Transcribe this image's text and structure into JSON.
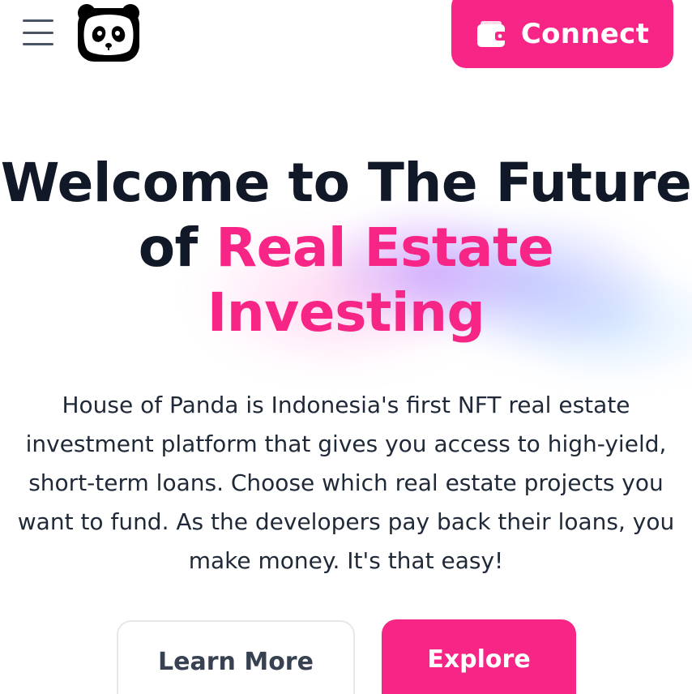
{
  "header": {
    "menu_icon": "hamburger-menu-icon",
    "logo_icon": "panda-logo-icon",
    "connect_button": {
      "label": "Connect",
      "icon": "wallet-icon"
    }
  },
  "hero": {
    "title_line1": "Welcome to The Future",
    "title_line2_prefix": "of ",
    "title_line2_accent": "Real Estate",
    "title_line3_accent": "Investing",
    "description": "House of Panda is Indonesia's first NFT real estate investment platform that gives you access to high-yield, short-term loans. Choose which real estate projects you want to fund. As the developers pay back their loans, you make money. It's that easy!"
  },
  "actions": {
    "learn_more_label": "Learn More",
    "explore_label": "Explore"
  },
  "colors": {
    "accent": "#f72585",
    "heading": "#111827",
    "body_text": "#1f2937"
  }
}
